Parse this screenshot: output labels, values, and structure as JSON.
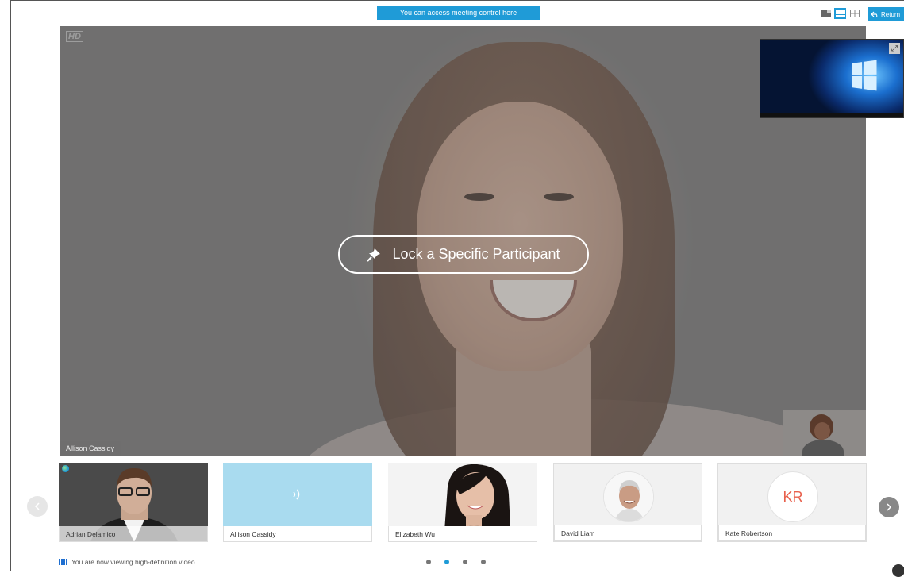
{
  "banner": {
    "text": "You can access meeting control here"
  },
  "toolbar": {
    "return_label": "Return"
  },
  "main_video": {
    "badge": "HD",
    "participant_name": "Allison Cassidy",
    "lock_label": "Lock a Specific Participant"
  },
  "participants": [
    {
      "name": "Adrian Delamico",
      "type": "video",
      "active": true
    },
    {
      "name": "Allison Cassidy",
      "type": "speaking"
    },
    {
      "name": "Elizabeth Wu",
      "type": "video"
    },
    {
      "name": "David Liam",
      "type": "avatar",
      "muted": true
    },
    {
      "name": "Kate Robertson",
      "type": "initials",
      "initials": "KR"
    }
  ],
  "status": {
    "text": "You are now viewing high-definition video."
  },
  "pagination": {
    "pages": 4,
    "current": 2
  },
  "colors": {
    "accent": "#1f9bd7",
    "muted": "#d83a2f",
    "initials": "#e8604c"
  }
}
